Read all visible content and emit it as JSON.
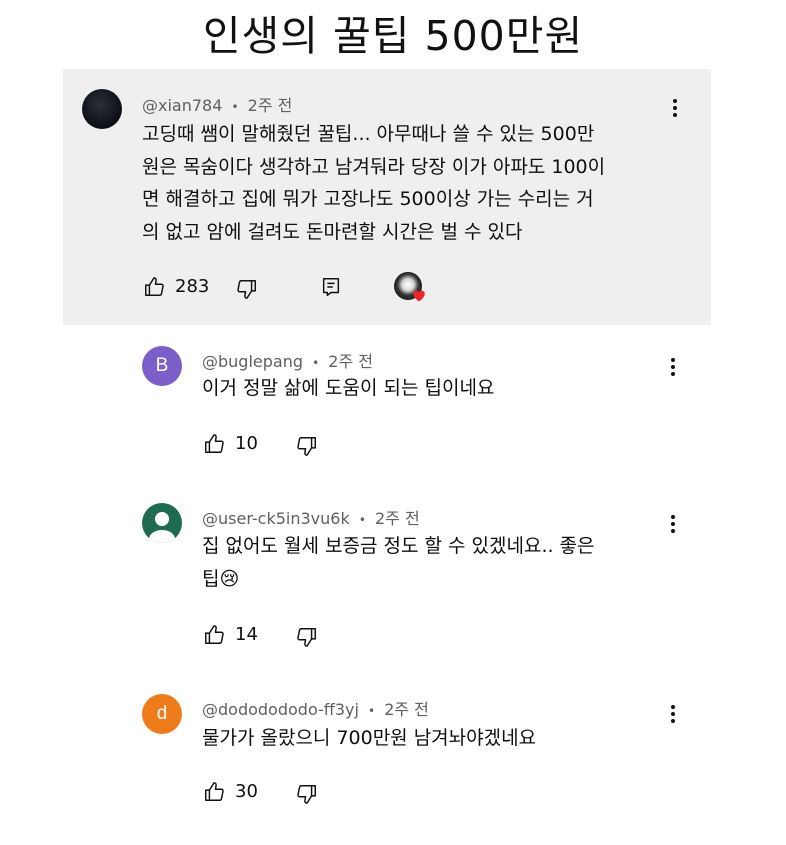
{
  "page_title": "인생의 꿀팁 500만원",
  "top_comment": {
    "author": "@xian784",
    "time": "2주 전",
    "text": "고딩때 쌤이 말해줬던 꿀팁... 아무때나 쓸 수 있는 500만원은 목숨이다 생각하고 남겨둬라 당장 이가 아파도 100이면 해결하고 집에 뭐가 고장나도 500이상 가는 수리는 거의 없고 암에 걸려도 돈마련할 시간은 벌 수 있다",
    "text_lines": [
      "고딩때 쌤이 말해줬던 꿀팁... 아무때나 쓸 수 있는 500만",
      "원은 목숨이다 생각하고 남겨둬라 당장 이가 아파도 100이",
      "면 해결하고 집에 뭐가 고장나도 500이상 가는 수리는 거",
      "의 없고 암에 걸려도 돈마련할 시간은 벌 수 있다"
    ],
    "likes": "283",
    "icons": [
      "like-icon",
      "dislike-icon",
      "reply-icon",
      "creator-heart-icon"
    ]
  },
  "replies": [
    {
      "avatar_letter": "B",
      "avatar_color": "#7b5ec7",
      "author": "@buglepang",
      "time": "2주 전",
      "text_lines": [
        "이거 정말 삶에 도움이 되는 팁이네요"
      ],
      "likes": "10"
    },
    {
      "avatar_letter": "",
      "avatar_color": "#1f6b4f",
      "author": "@user-ck5in3vu6k",
      "time": "2주 전",
      "text_lines": [
        "집 없어도 월세 보증금 정도 할 수 있겠네요.. 좋은",
        "팁😢"
      ],
      "likes": "14"
    },
    {
      "avatar_letter": "d",
      "avatar_color": "#ef7c1a",
      "author": "@dododododo-ff3yj",
      "time": "2주 전",
      "text_lines": [
        "물가가 올랐으니 700만원 남겨놔야겠네요"
      ],
      "likes": "30"
    }
  ],
  "meta_separator": "•"
}
